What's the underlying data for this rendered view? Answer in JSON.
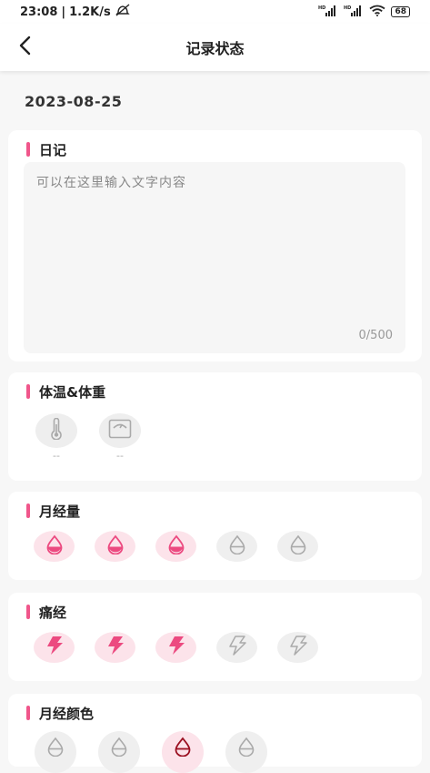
{
  "status_bar": {
    "time": "23:08",
    "separator": "|",
    "network_speed": "1.2K/s",
    "battery": "68"
  },
  "header": {
    "title": "记录状态",
    "back_icon": "chevron-left-icon"
  },
  "date": "2023-08-25",
  "diary": {
    "title": "日记",
    "placeholder": "可以在这里输入文字内容",
    "count": "0/500"
  },
  "temp_weight": {
    "title": "体温&体重",
    "temperature_value": "--",
    "weight_value": "--"
  },
  "flow": {
    "title": "月经量",
    "levels": [
      true,
      true,
      true,
      false,
      false
    ]
  },
  "pain": {
    "title": "痛经",
    "levels": [
      true,
      true,
      true,
      false,
      false
    ]
  },
  "period_color": {
    "title": "月经颜色",
    "selected_index": 2
  },
  "colors": {
    "accent": "#f0568b",
    "icon_active": "#ec4a80",
    "icon_inactive": "#aaaaaa",
    "active_bg": "#fce3ea",
    "inactive_bg": "#efefef",
    "dark_red": "#9b1021"
  }
}
